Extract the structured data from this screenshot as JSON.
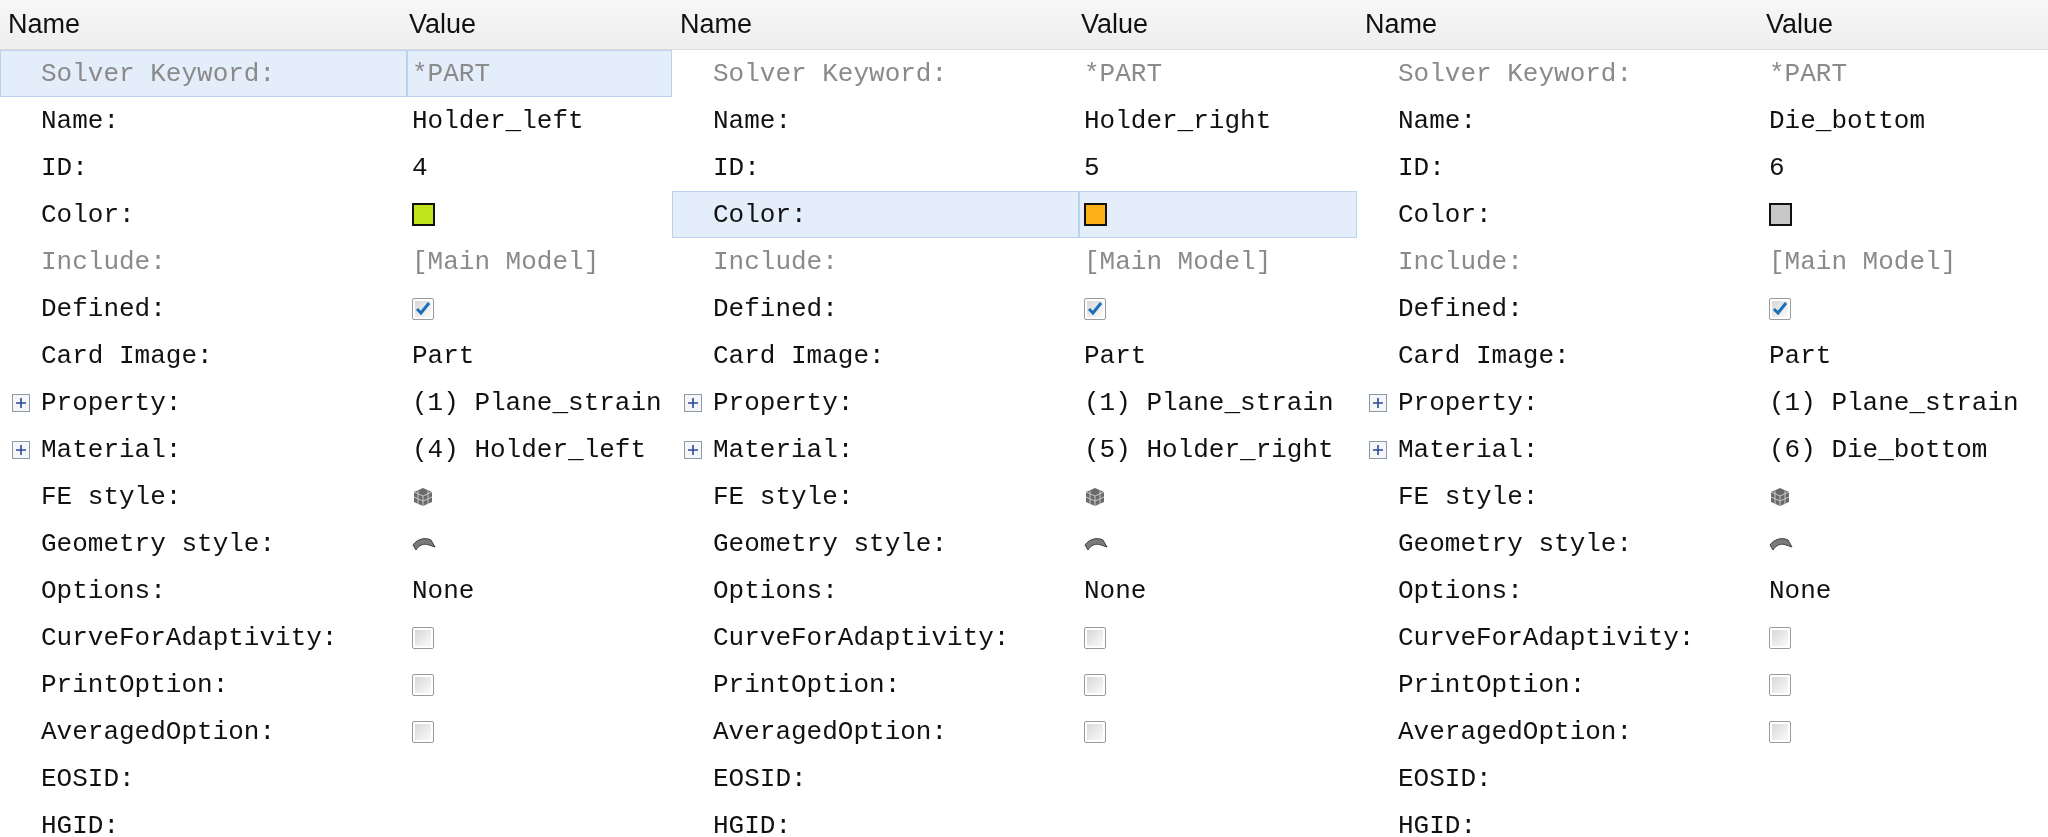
{
  "panels": [
    {
      "columns": [
        "Name",
        "Value"
      ],
      "rows": [
        {
          "kind": "text",
          "name": "Solver Keyword:",
          "value": "*PART",
          "disabled": true,
          "selected": true
        },
        {
          "kind": "text",
          "name": "Name:",
          "value": "Holder_left",
          "disabled": false,
          "selected": false
        },
        {
          "kind": "text",
          "name": "ID:",
          "value": "4",
          "disabled": false,
          "selected": false
        },
        {
          "kind": "color",
          "name": "Color:",
          "color": "#c0e31a",
          "disabled": false,
          "selected": false
        },
        {
          "kind": "text",
          "name": "Include:",
          "value": "[Main Model]",
          "disabled": true,
          "selected": false
        },
        {
          "kind": "checkbox",
          "name": "Defined:",
          "checked": true,
          "disabled": false,
          "selected": false
        },
        {
          "kind": "text",
          "name": "Card Image:",
          "value": "Part",
          "disabled": false,
          "selected": false
        },
        {
          "kind": "text",
          "name": "Property:",
          "value": "(1) Plane_strain",
          "expanded": false,
          "disabled": false,
          "selected": false
        },
        {
          "kind": "text",
          "name": "Material:",
          "value": "(4) Holder_left",
          "expanded": false,
          "disabled": false,
          "selected": false
        },
        {
          "kind": "mesh-style",
          "name": "FE style:",
          "disabled": false,
          "selected": false
        },
        {
          "kind": "geometry-style",
          "name": "Geometry style:",
          "disabled": false,
          "selected": false
        },
        {
          "kind": "text",
          "name": "Options:",
          "value": "None",
          "disabled": false,
          "selected": false
        },
        {
          "kind": "checkbox",
          "name": "CurveForAdaptivity:",
          "checked": false,
          "disabled": false,
          "selected": false
        },
        {
          "kind": "checkbox",
          "name": "PrintOption:",
          "checked": false,
          "disabled": false,
          "selected": false
        },
        {
          "kind": "checkbox",
          "name": "AveragedOption:",
          "checked": false,
          "disabled": false,
          "selected": false
        },
        {
          "kind": "text",
          "name": "EOSID:",
          "disabled": false,
          "selected": false
        },
        {
          "kind": "text",
          "name": "HGID:",
          "disabled": false,
          "selected": false
        }
      ]
    },
    {
      "columns": [
        "Name",
        "Value"
      ],
      "rows": [
        {
          "kind": "text",
          "name": "Solver Keyword:",
          "value": "*PART",
          "disabled": true,
          "selected": false
        },
        {
          "kind": "text",
          "name": "Name:",
          "value": "Holder_right",
          "disabled": false,
          "selected": false
        },
        {
          "kind": "text",
          "name": "ID:",
          "value": "5",
          "disabled": false,
          "selected": false
        },
        {
          "kind": "color",
          "name": "Color:",
          "color": "#fbb117",
          "disabled": false,
          "selected": true
        },
        {
          "kind": "text",
          "name": "Include:",
          "value": "[Main Model]",
          "disabled": true,
          "selected": false
        },
        {
          "kind": "checkbox",
          "name": "Defined:",
          "checked": true,
          "disabled": false,
          "selected": false
        },
        {
          "kind": "text",
          "name": "Card Image:",
          "value": "Part",
          "disabled": false,
          "selected": false
        },
        {
          "kind": "text",
          "name": "Property:",
          "value": "(1) Plane_strain",
          "expanded": false,
          "disabled": false,
          "selected": false
        },
        {
          "kind": "text",
          "name": "Material:",
          "value": "(5) Holder_right",
          "expanded": false,
          "disabled": false,
          "selected": false
        },
        {
          "kind": "mesh-style",
          "name": "FE style:",
          "disabled": false,
          "selected": false
        },
        {
          "kind": "geometry-style",
          "name": "Geometry style:",
          "disabled": false,
          "selected": false
        },
        {
          "kind": "text",
          "name": "Options:",
          "value": "None",
          "disabled": false,
          "selected": false
        },
        {
          "kind": "checkbox",
          "name": "CurveForAdaptivity:",
          "checked": false,
          "disabled": false,
          "selected": false
        },
        {
          "kind": "checkbox",
          "name": "PrintOption:",
          "checked": false,
          "disabled": false,
          "selected": false
        },
        {
          "kind": "checkbox",
          "name": "AveragedOption:",
          "checked": false,
          "disabled": false,
          "selected": false
        },
        {
          "kind": "text",
          "name": "EOSID:",
          "disabled": false,
          "selected": false
        },
        {
          "kind": "text",
          "name": "HGID:",
          "disabled": false,
          "selected": false
        }
      ]
    },
    {
      "columns": [
        "Name",
        "Value"
      ],
      "rows": [
        {
          "kind": "text",
          "name": "Solver Keyword:",
          "value": "*PART",
          "disabled": true,
          "selected": false
        },
        {
          "kind": "text",
          "name": "Name:",
          "value": "Die_bottom",
          "disabled": false,
          "selected": false
        },
        {
          "kind": "text",
          "name": "ID:",
          "value": "6",
          "disabled": false,
          "selected": false
        },
        {
          "kind": "color",
          "name": "Color:",
          "color": "#c8c8c8",
          "disabled": false,
          "selected": false
        },
        {
          "kind": "text",
          "name": "Include:",
          "value": "[Main Model]",
          "disabled": true,
          "selected": false
        },
        {
          "kind": "checkbox",
          "name": "Defined:",
          "checked": true,
          "disabled": false,
          "selected": false
        },
        {
          "kind": "text",
          "name": "Card Image:",
          "value": "Part",
          "disabled": false,
          "selected": false
        },
        {
          "kind": "text",
          "name": "Property:",
          "value": "(1) Plane_strain",
          "expanded": false,
          "disabled": false,
          "selected": false
        },
        {
          "kind": "text",
          "name": "Material:",
          "value": "(6) Die_bottom",
          "expanded": false,
          "disabled": false,
          "selected": false
        },
        {
          "kind": "mesh-style",
          "name": "FE style:",
          "disabled": false,
          "selected": false
        },
        {
          "kind": "geometry-style",
          "name": "Geometry style:",
          "disabled": false,
          "selected": false
        },
        {
          "kind": "text",
          "name": "Options:",
          "value": "None",
          "disabled": false,
          "selected": false
        },
        {
          "kind": "checkbox",
          "name": "CurveForAdaptivity:",
          "checked": false,
          "disabled": false,
          "selected": false
        },
        {
          "kind": "checkbox",
          "name": "PrintOption:",
          "checked": false,
          "disabled": false,
          "selected": false
        },
        {
          "kind": "checkbox",
          "name": "AveragedOption:",
          "checked": false,
          "disabled": false,
          "selected": false
        },
        {
          "kind": "text",
          "name": "EOSID:",
          "disabled": false,
          "selected": false
        },
        {
          "kind": "text",
          "name": "HGID:",
          "disabled": false,
          "selected": false
        }
      ]
    }
  ]
}
